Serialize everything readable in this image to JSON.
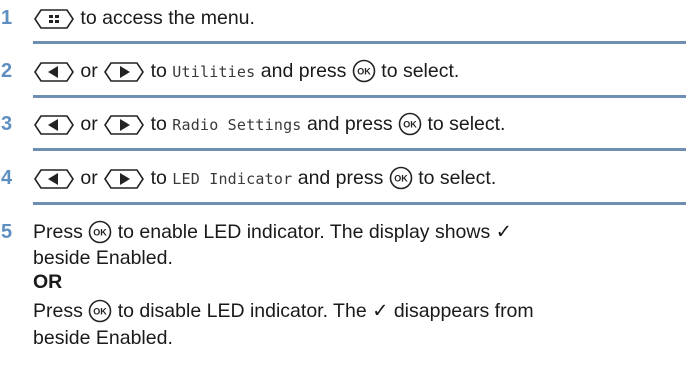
{
  "colors": {
    "accent": "#5f8fc1",
    "rule": "#6e8fb3"
  },
  "steps": [
    {
      "num": "1",
      "t1": "to access the menu."
    },
    {
      "num": "2",
      "t1": "or",
      "t2": "to",
      "code": "Utilities",
      "t3": "and press",
      "t4": "to select."
    },
    {
      "num": "3",
      "t1": "or",
      "t2": "to",
      "code": "Radio Settings",
      "t3": "and press",
      "t4": "to select."
    },
    {
      "num": "4",
      "t1": "or",
      "t2": "to",
      "code": "LED Indicator",
      "t3": "and press",
      "t4": "to select."
    },
    {
      "num": "5",
      "a1": "Press",
      "a2": "to enable LED indicator. The display shows ✓",
      "a3": "beside Enabled.",
      "or": "OR",
      "b1": "Press",
      "b2": "to disable LED indicator. The ✓ disappears from",
      "b3": "beside Enabled."
    }
  ],
  "icons": {
    "menu": "menu-button-icon",
    "left": "left-arrow-button-icon",
    "right": "right-arrow-button-icon",
    "ok": "ok-button-icon",
    "ok_label": "OK"
  }
}
